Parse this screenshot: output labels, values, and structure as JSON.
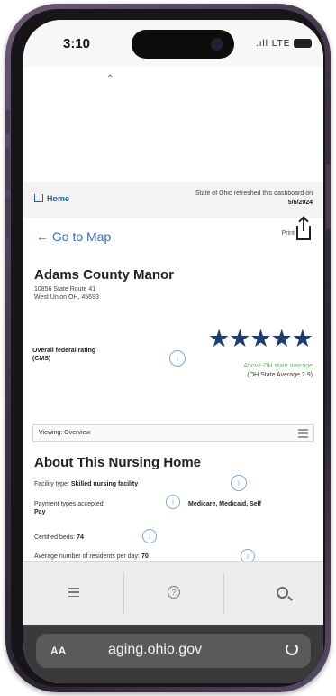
{
  "status_bar": {
    "time": "3:10",
    "signal": ".ıll LTE"
  },
  "page": {
    "home_link": "Home",
    "refresh_text": "State of Ohio refreshed this dashboard on",
    "refresh_date": "5/6/2024",
    "go_to_map": "← Go to Map",
    "print_label": "Print",
    "facility": {
      "name": "Adams County Manor",
      "address_line1": "10856 State Route 41",
      "address_line2": "West Union OH, 45693"
    },
    "rating": {
      "label": "Overall federal rating (CMS)",
      "stars": "★★★★★",
      "sub1": "Above OH state average",
      "sub2": "(OH State Average 2.9)",
      "value": 5,
      "max": 5
    },
    "viewing": {
      "label": "Viewing: Overview"
    },
    "about": {
      "title": "About This Nursing Home",
      "facility_type_label": "Facility type:",
      "facility_type_value": "Skilled nursing facility",
      "payment_label": "Payment types accepted:",
      "payment_value": "Medicare, Medicaid, Self",
      "payment_value_cont": "Pay",
      "beds_label": "Certified beds:",
      "beds_value": "74",
      "residents_label": "Average number of residents per day:",
      "residents_value": "70"
    }
  },
  "toolbar": {
    "menu": "menu",
    "help": "help",
    "search": "search"
  },
  "browser": {
    "aa": "AA",
    "url": "aging.ohio.gov"
  },
  "colors": {
    "star": "#1f3d6e",
    "link": "#3d6fb5",
    "above_avg": "#79b27a"
  }
}
